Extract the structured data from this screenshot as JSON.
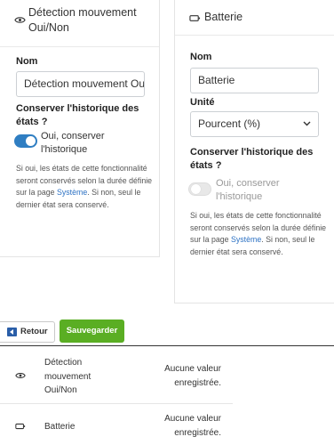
{
  "features": [
    {
      "header_icon": "eye-icon",
      "title": "Détection mouvement Oui/Non",
      "name_label": "Nom",
      "name_value": "Détection mouvement Oui/Non",
      "history_label": "Conserver l'historique des états ?",
      "history_toggle_label": "Oui, conserver l'historique",
      "history_enabled": true,
      "help_text_prefix": "Si oui, les états de cette fonctionnalité seront conservés selon la durée définie sur la page",
      "help_link": "Système",
      "help_text_suffix": ". Si non, seul le dernier état sera conservé."
    },
    {
      "header_icon": "battery-icon",
      "title": "Batterie",
      "name_label": "Nom",
      "name_value": "Batterie",
      "unit_label": "Unité",
      "unit_value": "Pourcent (%)",
      "history_label": "Conserver l'historique des états ?",
      "history_toggle_label": "Oui, conserver l'historique",
      "history_enabled": false,
      "help_text_prefix": "Si oui, les états de cette fonctionnalité seront conservés selon la durée définie sur la page",
      "help_link": "Système",
      "help_text_suffix": ". Si non, seul le dernier état sera conservé."
    }
  ],
  "actions": {
    "back_label": "Retour",
    "save_label": "Sauvegarder"
  },
  "list": [
    {
      "icon": "eye-icon",
      "name": "Détection mouvement Oui/Non",
      "value": "Aucune valeur enregistrée."
    },
    {
      "icon": "battery-icon",
      "name": "Batterie",
      "value": "Aucune valeur enregistrée."
    }
  ],
  "colors": {
    "toggle_on": "#2f7ec2",
    "save_button": "#5aae23",
    "link": "#2d72c4"
  }
}
